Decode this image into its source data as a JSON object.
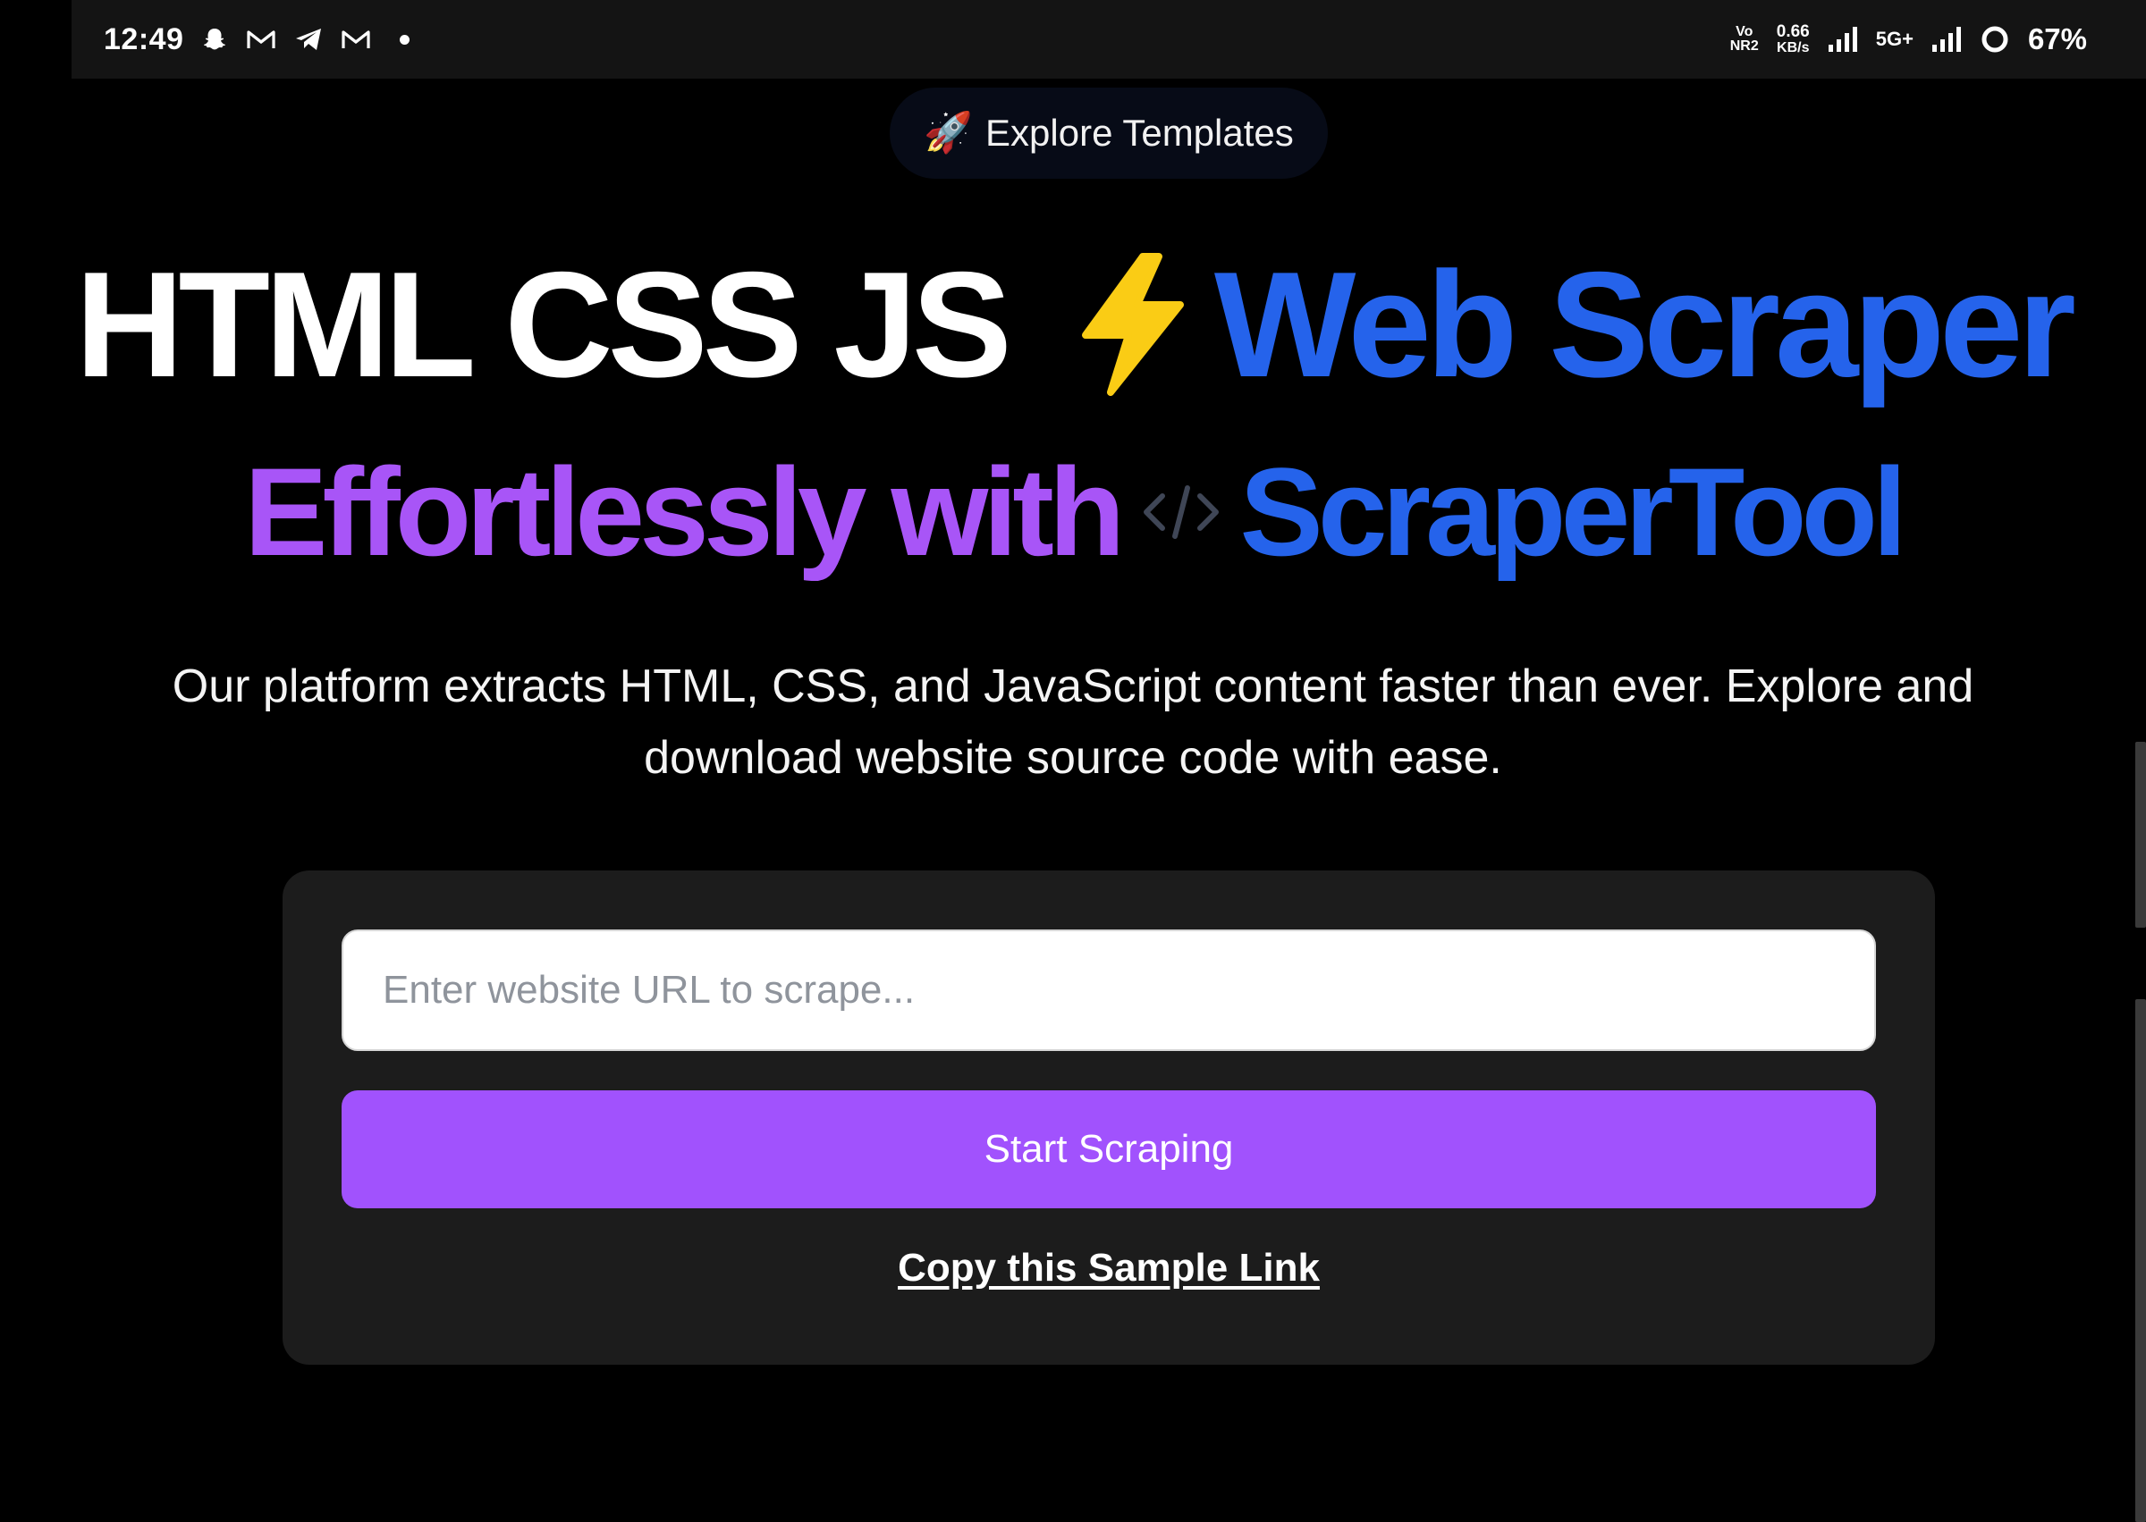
{
  "status_bar": {
    "time": "12:49",
    "left_icons": [
      "snapchat-icon",
      "gmail-icon",
      "telegram-icon",
      "gmail-icon"
    ],
    "volte_top": "Vo",
    "volte_bottom": "NR2",
    "net_speed_value": "0.66",
    "net_speed_unit": "KB/s",
    "network_type": "5G+",
    "battery_percent": "67%"
  },
  "explore": {
    "emoji": "🚀",
    "label": "Explore Templates"
  },
  "headline": {
    "line1_white": "HTML CSS JS",
    "line1_blue": "Web Scraper",
    "line2_purple": "Effortlessly with",
    "line2_blue": "ScraperTool"
  },
  "description": "Our platform extracts HTML, CSS, and JavaScript content faster than ever. Explore and download website source code with ease.",
  "form": {
    "url_placeholder": "Enter website URL to scrape...",
    "url_value": "",
    "start_label": "Start Scraping",
    "sample_link_label": "Copy this Sample Link"
  },
  "colors": {
    "background": "#000000",
    "accent_blue": "#2563eb",
    "accent_purple": "#a855f7",
    "button_purple": "#a152fd",
    "bolt_yellow": "#facc15",
    "card_bg": "#1c1c1c"
  }
}
